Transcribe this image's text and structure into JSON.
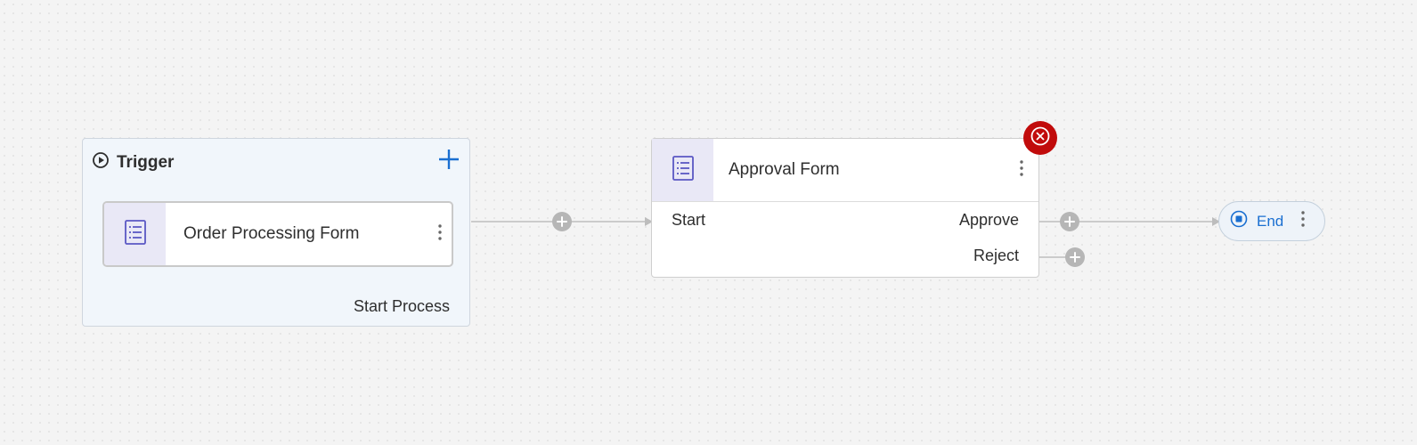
{
  "trigger": {
    "title": "Trigger",
    "add_icon": "plus-icon",
    "form": {
      "label": "Order Processing Form",
      "icon": "form-list-icon",
      "menu_icon": "kebab-icon"
    },
    "output_label": "Start Process"
  },
  "approval": {
    "title": "Approval Form",
    "icon": "form-list-icon",
    "menu_icon": "kebab-icon",
    "error_icon": "error-x-icon",
    "ports": {
      "input": "Start",
      "approve": "Approve",
      "reject": "Reject"
    }
  },
  "end": {
    "label": "End",
    "icon": "stop-icon",
    "menu_icon": "kebab-icon"
  },
  "colors": {
    "accent_blue": "#1a6fd1",
    "error_red": "#c10b0b",
    "connector_gray": "#b6b6b6",
    "form_icon_bg": "#e9e8f6",
    "form_icon": "#5a57c4"
  }
}
